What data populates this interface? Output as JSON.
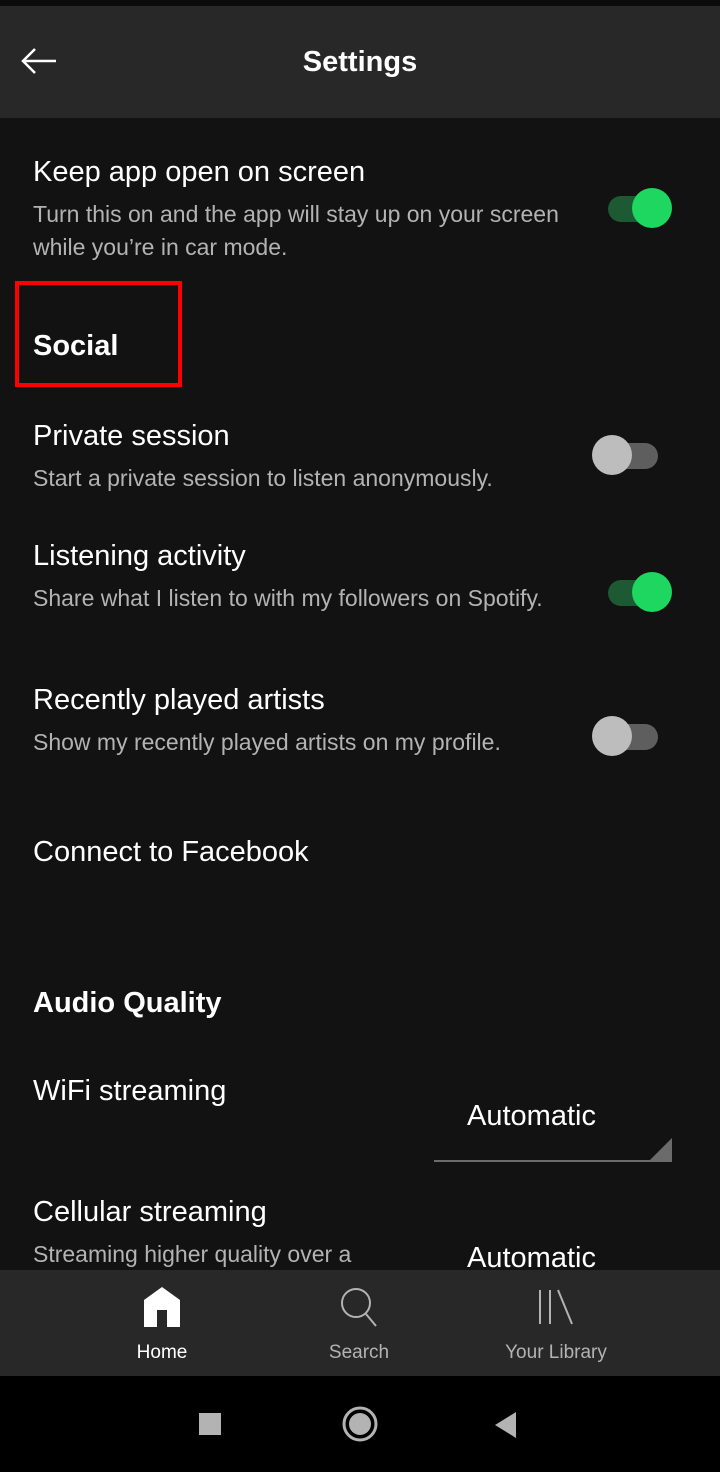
{
  "header": {
    "title": "Settings",
    "back_icon": "arrow-left-icon"
  },
  "settings": {
    "keep_open": {
      "title": "Keep app open on screen",
      "desc": "Turn this on and the app will stay up on your screen while you’re in car mode.",
      "enabled": true
    },
    "social_header": "Social",
    "private_session": {
      "title": "Private session",
      "desc": "Start a private session to listen anonymously.",
      "enabled": false
    },
    "listening_activity": {
      "title": "Listening activity",
      "desc": "Share what I listen to with my followers on Spotify.",
      "enabled": true
    },
    "recent_artists": {
      "title": "Recently played artists",
      "desc": "Show my recently played artists on my profile.",
      "enabled": false
    },
    "connect_facebook": "Connect to Facebook",
    "audio_header": "Audio Quality",
    "wifi_streaming": {
      "title": "WiFi streaming",
      "value": "Automatic"
    },
    "cellular_streaming": {
      "title": "Cellular streaming",
      "desc": "Streaming higher quality over a",
      "value": "Automatic"
    }
  },
  "tabs": [
    {
      "label": "Home",
      "icon": "home-icon",
      "active": true
    },
    {
      "label": "Search",
      "icon": "search-icon",
      "active": false
    },
    {
      "label": "Your Library",
      "icon": "library-icon",
      "active": false
    }
  ],
  "colors": {
    "accent": "#1ed760",
    "highlight": "#ff0000",
    "background": "#121212",
    "bar": "#282828"
  }
}
